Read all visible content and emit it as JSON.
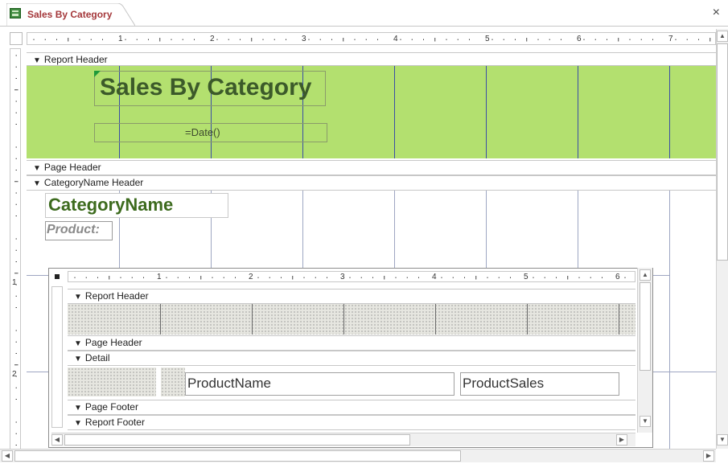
{
  "tab": {
    "title": "Sales By Category",
    "close": "×"
  },
  "ruler_numbers": [
    "1",
    "2",
    "3",
    "4",
    "5",
    "6",
    "7"
  ],
  "left_ruler_numbers": [
    "1",
    "2"
  ],
  "sections": {
    "report_header": "Report Header",
    "page_header": "Page Header",
    "category_header": "CategoryName Header"
  },
  "controls": {
    "title": "Sales By Category",
    "date_expr": "=Date()",
    "category_name": "CategoryName",
    "product_label": "Product:"
  },
  "subreport": {
    "ruler_numbers": [
      "1",
      "2",
      "3",
      "4",
      "5",
      "6"
    ],
    "sections": {
      "report_header": "Report Header",
      "page_header": "Page Header",
      "detail": "Detail",
      "page_footer": "Page Footer",
      "report_footer": "Report Footer"
    },
    "fields": {
      "product_name": "ProductName",
      "product_sales": "ProductSales"
    }
  },
  "icons": {
    "section_arrow": "section-collapse-icon",
    "report": "report-icon"
  },
  "colors": {
    "tab_title": "#a4373a",
    "header_band": "#b3e06f",
    "title_text": "#3c5a2a",
    "category_text": "#3d6b1e"
  }
}
